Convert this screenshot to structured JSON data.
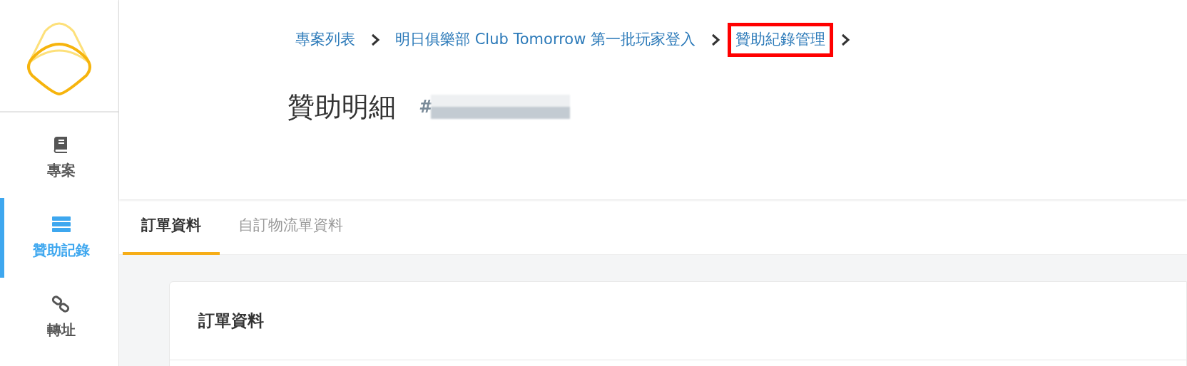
{
  "sidebar": {
    "items": [
      {
        "label": "專案",
        "kind": "book",
        "selected": false
      },
      {
        "label": "贊助記錄",
        "kind": "list",
        "selected": true
      },
      {
        "label": "轉址",
        "kind": "link",
        "selected": false
      }
    ]
  },
  "breadcrumb": [
    {
      "label": "專案列表",
      "highlighted": false
    },
    {
      "label": "明日俱樂部 Club Tomorrow 第一批玩家登入",
      "highlighted": false
    },
    {
      "label": "贊助紀錄管理",
      "highlighted": true
    }
  ],
  "page_title": "贊助明細",
  "id_prefix": "#",
  "tabs": [
    {
      "label": "訂單資料",
      "selected": true
    },
    {
      "label": "自訂物流單資料",
      "selected": false
    }
  ],
  "card": {
    "title": "訂單資料"
  }
}
